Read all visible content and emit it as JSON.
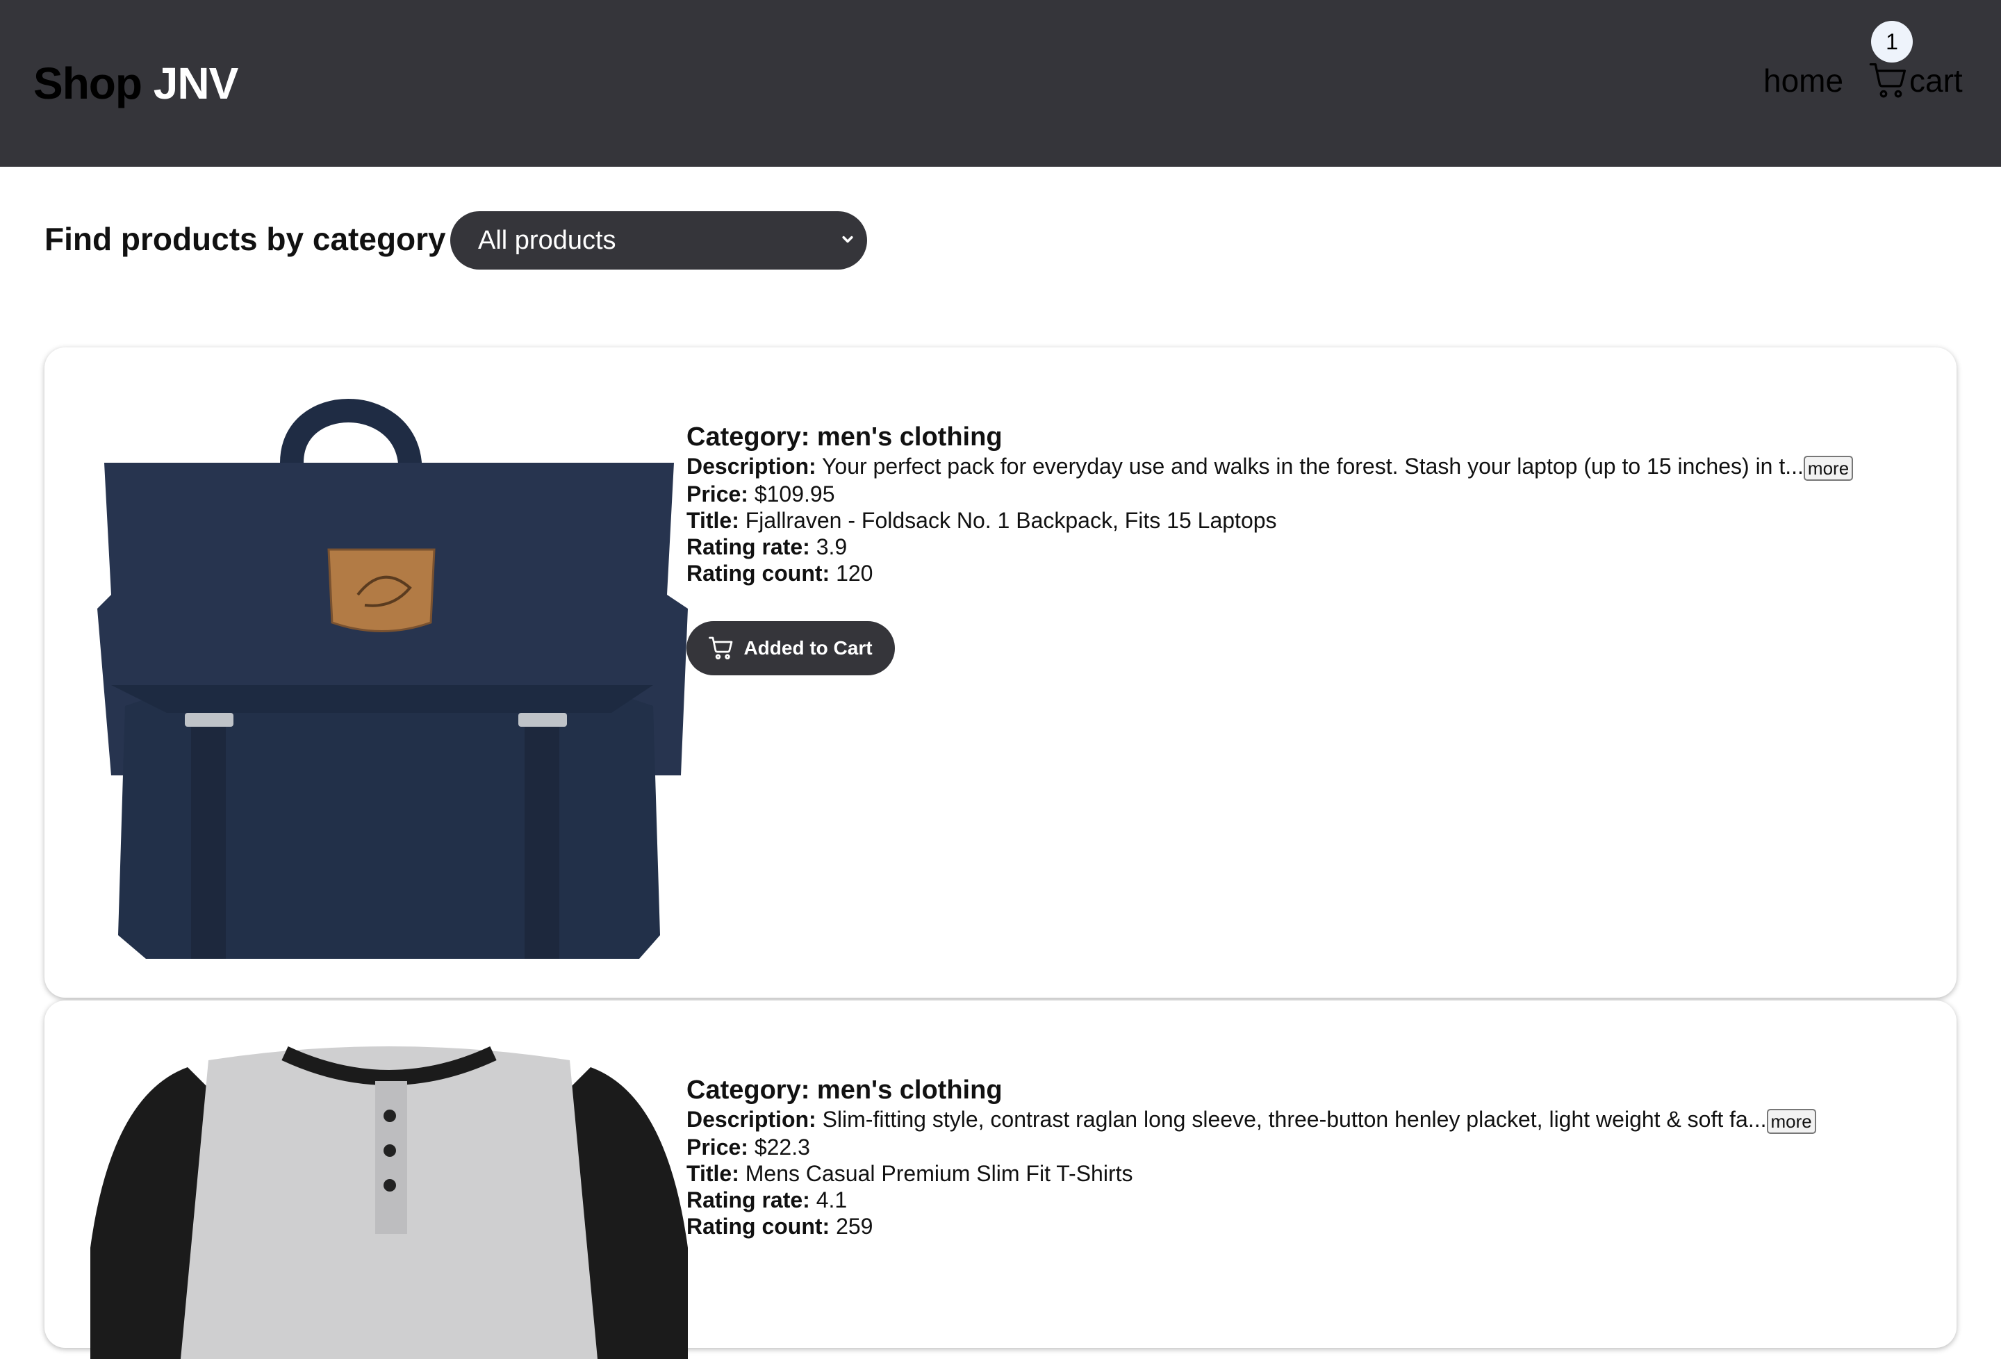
{
  "header": {
    "brand_dark": "Shop",
    "brand_light": "JNV",
    "home_label": "home",
    "cart_label": "cart",
    "cart_count": "1",
    "icons": [
      "cart-icon"
    ]
  },
  "filter": {
    "label": "Find products by category",
    "selected": "All products"
  },
  "products": [
    {
      "category": "Category: men's clothing",
      "description_label": "Description:",
      "description": "Your perfect pack for everyday use and walks in the forest. Stash your laptop (up to 15 inches) in t...",
      "more_label": "more",
      "price_label": "Price:",
      "price": "$109.95",
      "title_label": "Title:",
      "title": "Fjallraven - Foldsack No. 1 Backpack, Fits 15 Laptops",
      "rating_rate_label": "Rating rate:",
      "rating_rate": "3.9",
      "rating_count_label": "Rating count:",
      "rating_count": "120",
      "cart_button_label": "Added to Cart"
    },
    {
      "category": "Category: men's clothing",
      "description_label": "Description:",
      "description": "Slim-fitting style, contrast raglan long sleeve, three-button henley placket, light weight & soft fa...",
      "more_label": "more",
      "price_label": "Price:",
      "price": "$22.3",
      "title_label": "Title:",
      "title": "Mens Casual Premium Slim Fit T-Shirts",
      "rating_rate_label": "Rating rate:",
      "rating_rate": "4.1",
      "rating_count_label": "Rating count:",
      "rating_count": "259"
    }
  ],
  "colors": {
    "header_bg": "#35353a",
    "button_bg": "#35353a",
    "backpack": "#26344e",
    "patch": "#b27b45"
  }
}
